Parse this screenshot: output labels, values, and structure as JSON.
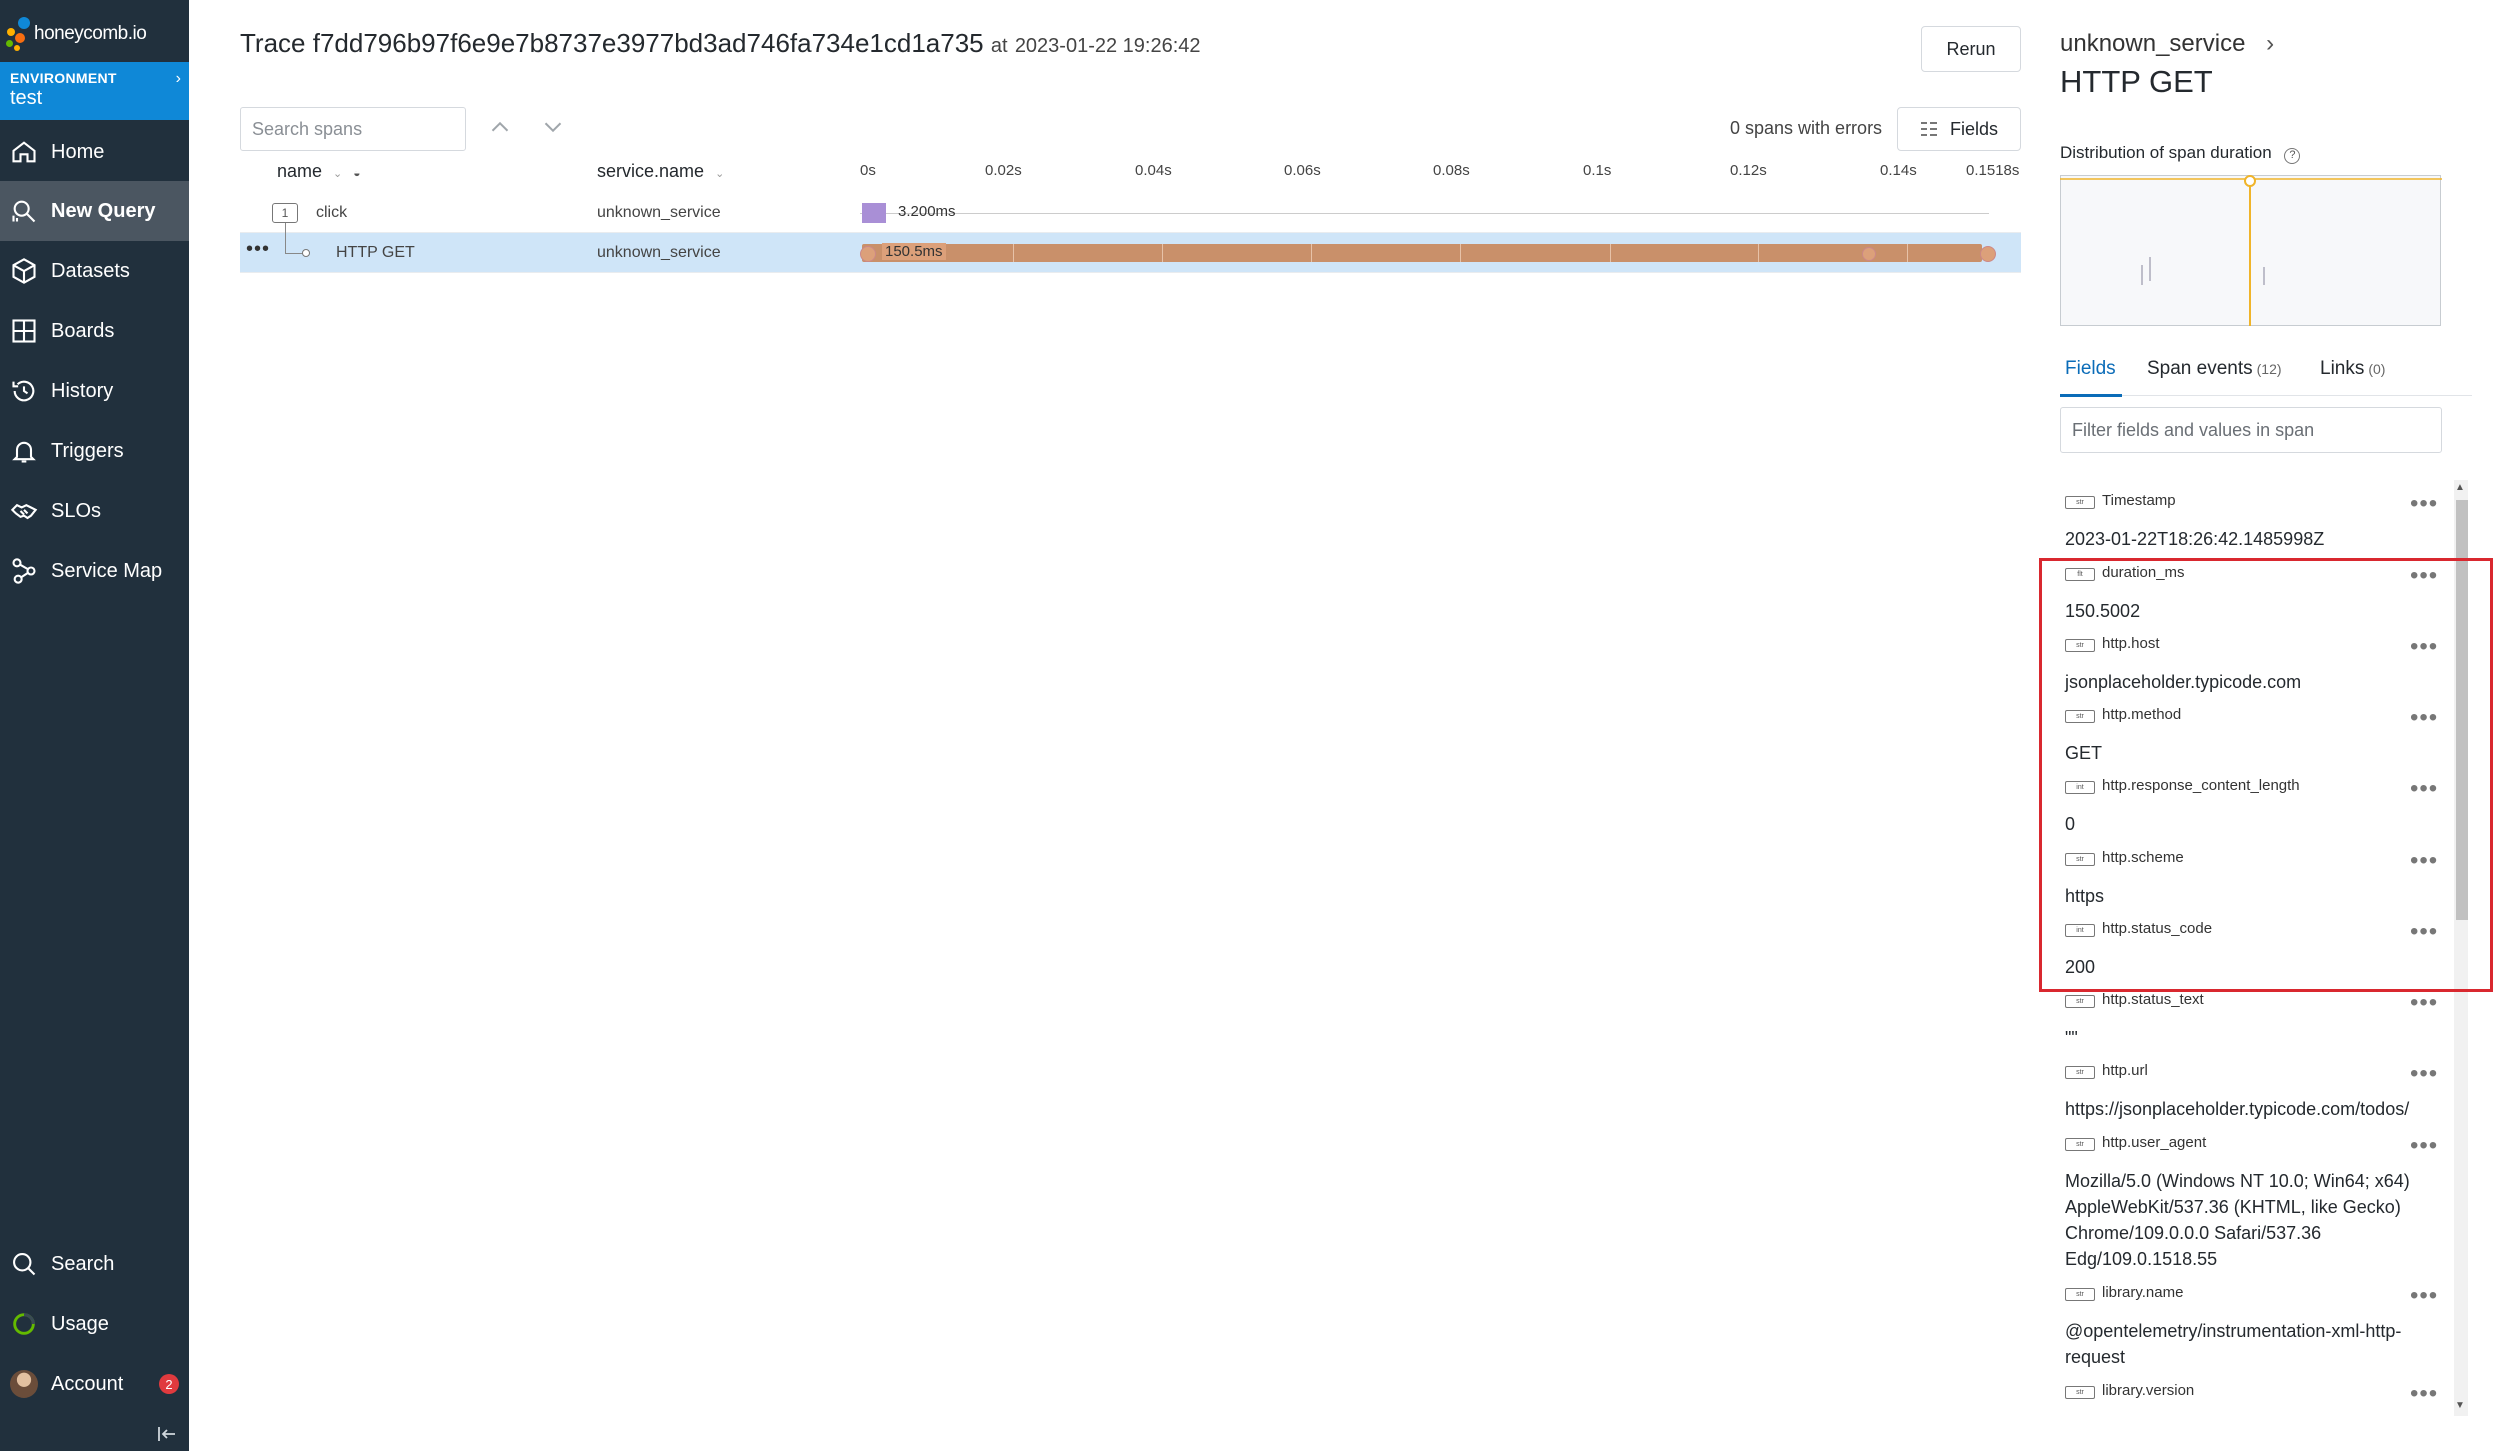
{
  "sidebar": {
    "logo_text": "honeycomb.io",
    "environment_label": "ENVIRONMENT",
    "environment_value": "test",
    "nav": [
      {
        "label": "Home",
        "icon": "home-icon"
      },
      {
        "label": "New Query",
        "icon": "new-query-icon"
      },
      {
        "label": "Datasets",
        "icon": "datasets-icon"
      },
      {
        "label": "Boards",
        "icon": "boards-icon"
      },
      {
        "label": "History",
        "icon": "history-icon"
      },
      {
        "label": "Triggers",
        "icon": "bell-icon"
      },
      {
        "label": "SLOs",
        "icon": "handshake-icon"
      },
      {
        "label": "Service Map",
        "icon": "service-map-icon"
      }
    ],
    "bottom_nav": [
      {
        "label": "Search",
        "icon": "search-icon"
      },
      {
        "label": "Usage",
        "icon": "usage-icon"
      },
      {
        "label": "Account",
        "icon": "avatar",
        "badge": "2"
      }
    ],
    "colors": {
      "background": "#21303d",
      "environment": "#0f88d7",
      "active": "#4b5661"
    }
  },
  "trace": {
    "title_prefix": "Trace",
    "trace_id": "f7dd796b97f6e9e7b8737e3977bd3ad746fa734e1cd1a735",
    "at_label": "at",
    "timestamp": "2023-01-22 19:26:42",
    "rerun_label": "Rerun",
    "search_placeholder": "Search spans",
    "errors_text": "0 spans with errors",
    "fields_button": "Fields",
    "columns": {
      "name": "name",
      "service": "service.name"
    },
    "timeline_ticks": [
      "0s",
      "0.02s",
      "0.04s",
      "0.06s",
      "0.08s",
      "0.1s",
      "0.12s",
      "0.14s",
      "0.1518s"
    ],
    "timeline_max": 0.1518,
    "spans": [
      {
        "name": "click",
        "service": "unknown_service",
        "duration_label": "3.200ms",
        "duration_ms": 3.2,
        "child_count": "1",
        "color": "#a98fd6",
        "selected": false
      },
      {
        "name": "HTTP GET",
        "service": "unknown_service",
        "duration_label": "150.5ms",
        "duration_ms": 150.5,
        "color": "#c9906a",
        "selected": true,
        "row_menu": "•••"
      }
    ]
  },
  "panel": {
    "service": "unknown_service",
    "span_name": "HTTP GET",
    "distribution_label": "Distribution of span duration",
    "tabs": [
      {
        "label": "Fields",
        "count": ""
      },
      {
        "label": "Span events",
        "count": "(12)"
      },
      {
        "label": "Links",
        "count": "(0)"
      }
    ],
    "filter_placeholder": "Filter fields and values in span",
    "fields": [
      {
        "type": "str",
        "name": "Timestamp",
        "value": "2023-01-22T18:26:42.1485998Z"
      },
      {
        "type": "flt",
        "name": "duration_ms",
        "value": "150.5002"
      },
      {
        "type": "str",
        "name": "http.host",
        "value": "jsonplaceholder.typicode.com"
      },
      {
        "type": "str",
        "name": "http.method",
        "value": "GET"
      },
      {
        "type": "int",
        "name": "http.response_content_length",
        "value": "0"
      },
      {
        "type": "str",
        "name": "http.scheme",
        "value": "https"
      },
      {
        "type": "int",
        "name": "http.status_code",
        "value": "200"
      },
      {
        "type": "str",
        "name": "http.status_text",
        "value": "\"\""
      },
      {
        "type": "str",
        "name": "http.url",
        "value": "https://jsonplaceholder.typicode.com/todos/"
      },
      {
        "type": "str",
        "name": "http.user_agent",
        "value": "Mozilla/5.0 (Windows NT 10.0; Win64; x64) AppleWebKit/537.36 (KHTML, like Gecko) Chrome/109.0.0.0 Safari/537.36 Edg/109.0.1518.55"
      },
      {
        "type": "str",
        "name": "library.name",
        "value": "@opentelemetry/instrumentation-xml-http-request"
      },
      {
        "type": "str",
        "name": "library.version",
        "value": ""
      }
    ],
    "menu_glyph": "•••",
    "accent": "#0b6cb8",
    "highlight_color": "#d9282f"
  }
}
